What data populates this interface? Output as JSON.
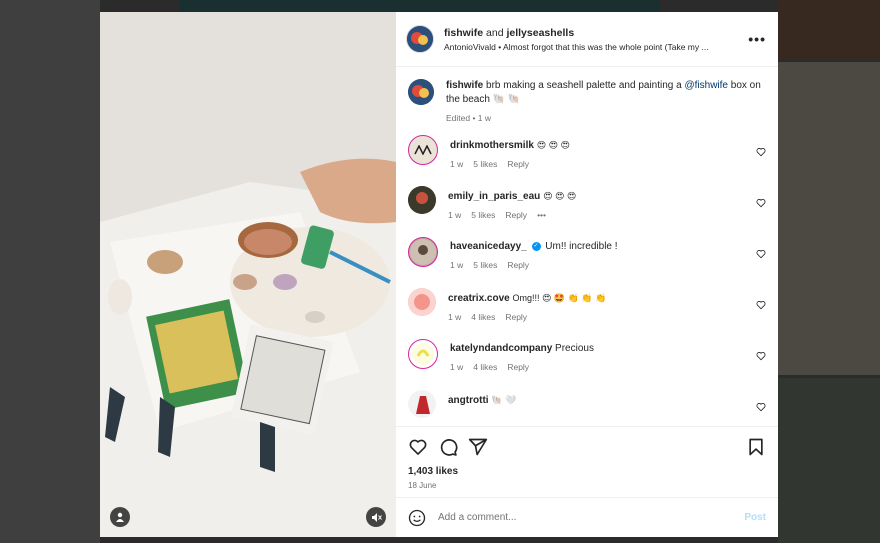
{
  "header": {
    "author": "fishwife",
    "connector": "and",
    "coauthor": "jellyseashells",
    "audio": "AntonioVivald • Almost forgot that this was the whole point (Take my ..."
  },
  "caption": {
    "user": "fishwife",
    "text": "brb making a seashell palette and painting a",
    "mention": "@fishwife",
    "text2": "box on the beach 🐚 🐚",
    "meta": "Edited • 1 w"
  },
  "comments": [
    {
      "user": "drinkmothersmilk",
      "text": "😍 😍 😍",
      "time": "1 w",
      "likes": "5 likes",
      "reply": "Reply",
      "avatar_color": "#e9e3d8",
      "avatar_mark": "AM"
    },
    {
      "user": "emily_in_paris_eau",
      "text": "😍 😍 😍",
      "time": "1 w",
      "likes": "5 likes",
      "reply": "Reply",
      "more": "•••",
      "avatar_color": "#3b3a2a",
      "avatar_mark": ""
    },
    {
      "user": "haveanicedayy_",
      "text": "Um!! incredible !",
      "time": "1 w",
      "likes": "5 likes",
      "reply": "Reply",
      "verified": true,
      "avatar_color": "#b8a99a",
      "avatar_mark": ""
    },
    {
      "user": "creatrix.cove",
      "text": "Omg!!! 😍 🤩 👏 👏 👏",
      "time": "1 w",
      "likes": "4 likes",
      "reply": "Reply",
      "avatar_color": "#f4b4ae",
      "avatar_mark": ""
    },
    {
      "user": "katelyndandcompany",
      "text": "Precious",
      "time": "1 w",
      "likes": "4 likes",
      "reply": "Reply",
      "avatar_color": "#f3f17a",
      "avatar_mark": ""
    },
    {
      "user": "angtrotti",
      "text": "🐚 🤍",
      "time": "",
      "likes": "",
      "reply": "",
      "avatar_color": "#c1272d",
      "avatar_mark": ""
    }
  ],
  "engagement": {
    "likes": "1,403 likes",
    "date": "18 June"
  },
  "add_comment": {
    "placeholder": "Add a comment...",
    "post": "Post"
  },
  "icons": [
    "more-options-icon",
    "heart-icon",
    "comment-icon",
    "share-icon",
    "save-icon",
    "emoji-icon",
    "user-tag-icon",
    "mute-icon"
  ],
  "colors": {
    "accent": "#0095f6",
    "mention": "#00376b",
    "post_disabled": "#b2dffc"
  }
}
